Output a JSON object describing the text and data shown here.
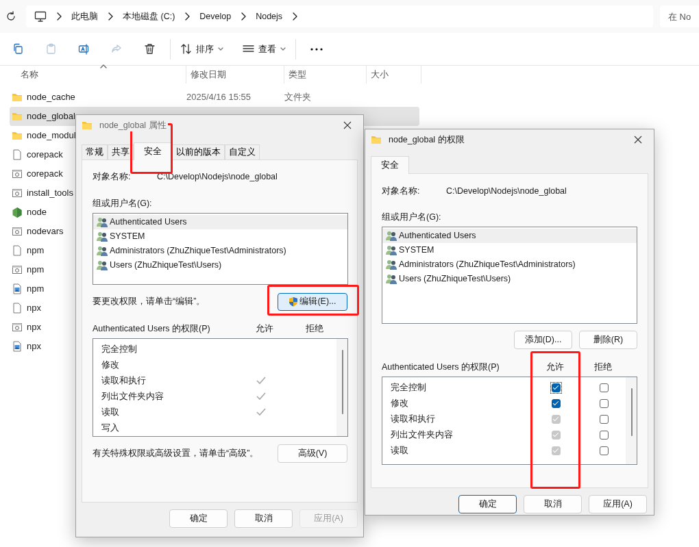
{
  "address_bar": {
    "breadcrumbs": [
      "此电脑",
      "本地磁盘 (C:)",
      "Develop",
      "Nodejs"
    ],
    "search_placeholder": "在 No"
  },
  "toolbar": {
    "buttons": [
      {
        "kind": "copy",
        "disabled": false
      },
      {
        "kind": "paste",
        "disabled": true
      },
      {
        "kind": "rename",
        "disabled": false
      },
      {
        "kind": "share",
        "disabled": true
      },
      {
        "kind": "delete",
        "disabled": false
      }
    ],
    "sort_label": "排序",
    "view_label": "查看"
  },
  "file_list": {
    "columns": [
      {
        "label": "名称",
        "sorted": true
      },
      {
        "label": "修改日期",
        "sorted": false
      },
      {
        "label": "类型",
        "sorted": false
      },
      {
        "label": "大小",
        "sorted": false
      }
    ],
    "rows": [
      {
        "name": "node_cache",
        "kind": "folder",
        "selected": false,
        "modified": "2025/4/16 15:55",
        "type": "文件夹"
      },
      {
        "name": "node_global",
        "kind": "folder",
        "selected": true
      },
      {
        "name": "node_modul",
        "kind": "folder",
        "selected": false
      },
      {
        "name": "corepack",
        "kind": "file",
        "selected": false
      },
      {
        "name": "corepack",
        "kind": "script",
        "selected": false
      },
      {
        "name": "install_tools",
        "kind": "script",
        "selected": false
      },
      {
        "name": "node",
        "kind": "node",
        "selected": false
      },
      {
        "name": "nodevars",
        "kind": "script",
        "selected": false
      },
      {
        "name": "npm",
        "kind": "file",
        "selected": false
      },
      {
        "name": "npm",
        "kind": "script",
        "selected": false
      },
      {
        "name": "npm",
        "kind": "image",
        "selected": false
      },
      {
        "name": "npx",
        "kind": "file",
        "selected": false
      },
      {
        "name": "npx",
        "kind": "script",
        "selected": false
      },
      {
        "name": "npx",
        "kind": "image",
        "selected": false
      }
    ]
  },
  "properties_dialog": {
    "title": "node_global 属性",
    "tabs": [
      {
        "label": "常规",
        "selected": false,
        "highlighted": false
      },
      {
        "label": "共享",
        "selected": false,
        "highlighted": false
      },
      {
        "label": "安全",
        "selected": true,
        "highlighted": true
      },
      {
        "label": "以前的版本",
        "selected": false,
        "highlighted": false
      },
      {
        "label": "自定义",
        "selected": false,
        "highlighted": false
      }
    ],
    "object_label": "对象名称:",
    "object_path": "C:\\Develop\\Nodejs\\node_global",
    "groups_label": "组或用户名(G):",
    "groups": [
      {
        "name": "Authenticated Users",
        "selected": true
      },
      {
        "name": "SYSTEM",
        "selected": false
      },
      {
        "name": "Administrators (ZhuZhiqueTest\\Administrators)",
        "selected": false
      },
      {
        "name": "Users (ZhuZhiqueTest\\Users)",
        "selected": false
      }
    ],
    "edit_hint": "要更改权限，请单击“编辑”。",
    "edit_button": {
      "label": "编辑(E)...",
      "highlighted": true
    },
    "permissions_label": "Authenticated Users 的权限(P)",
    "allow_header": "允许",
    "deny_header": "拒绝",
    "permissions": [
      {
        "name": "完全控制",
        "allow": false,
        "deny": false
      },
      {
        "name": "修改",
        "allow": false,
        "deny": false
      },
      {
        "name": "读取和执行",
        "allow": true,
        "deny": false
      },
      {
        "name": "列出文件夹内容",
        "allow": true,
        "deny": false
      },
      {
        "name": "读取",
        "allow": true,
        "deny": false
      },
      {
        "name": "写入",
        "allow": false,
        "deny": false
      }
    ],
    "advanced_hint": "有关特殊权限或高级设置，请单击“高级”。",
    "advanced_button": "高级(V)",
    "buttons": [
      {
        "label": "确定",
        "disabled": false
      },
      {
        "label": "取消",
        "disabled": false
      },
      {
        "label": "应用(A)",
        "disabled": true
      }
    ]
  },
  "permissions_dialog": {
    "title": "node_global 的权限",
    "tabs": [
      {
        "label": "安全",
        "selected": true
      }
    ],
    "object_label": "对象名称:",
    "object_path": "C:\\Develop\\Nodejs\\node_global",
    "groups_label": "组或用户名(G):",
    "groups": [
      {
        "name": "Authenticated Users",
        "selected": true
      },
      {
        "name": "SYSTEM",
        "selected": false
      },
      {
        "name": "Administrators (ZhuZhiqueTest\\Administrators)",
        "selected": false
      },
      {
        "name": "Users (ZhuZhiqueTest\\Users)",
        "selected": false
      }
    ],
    "add_button": "添加(D)...",
    "remove_button": "删除(R)",
    "permissions_label": "Authenticated Users 的权限(P)",
    "allow_header": "允许",
    "allow_highlighted": true,
    "deny_header": "拒绝",
    "permissions": [
      {
        "name": "完全控制",
        "allow": true,
        "allow_disabled": false,
        "focused": true,
        "deny": false
      },
      {
        "name": "修改",
        "allow": true,
        "allow_disabled": false,
        "focused": false,
        "deny": false
      },
      {
        "name": "读取和执行",
        "allow": true,
        "allow_disabled": true,
        "focused": false,
        "deny": false
      },
      {
        "name": "列出文件夹内容",
        "allow": true,
        "allow_disabled": true,
        "focused": false,
        "deny": false
      },
      {
        "name": "读取",
        "allow": true,
        "allow_disabled": true,
        "focused": false,
        "deny": false
      }
    ],
    "buttons": [
      {
        "label": "确定",
        "default": true,
        "disabled": false
      },
      {
        "label": "取消",
        "default": false,
        "disabled": false
      },
      {
        "label": "应用(A)",
        "default": false,
        "disabled": false
      }
    ]
  }
}
